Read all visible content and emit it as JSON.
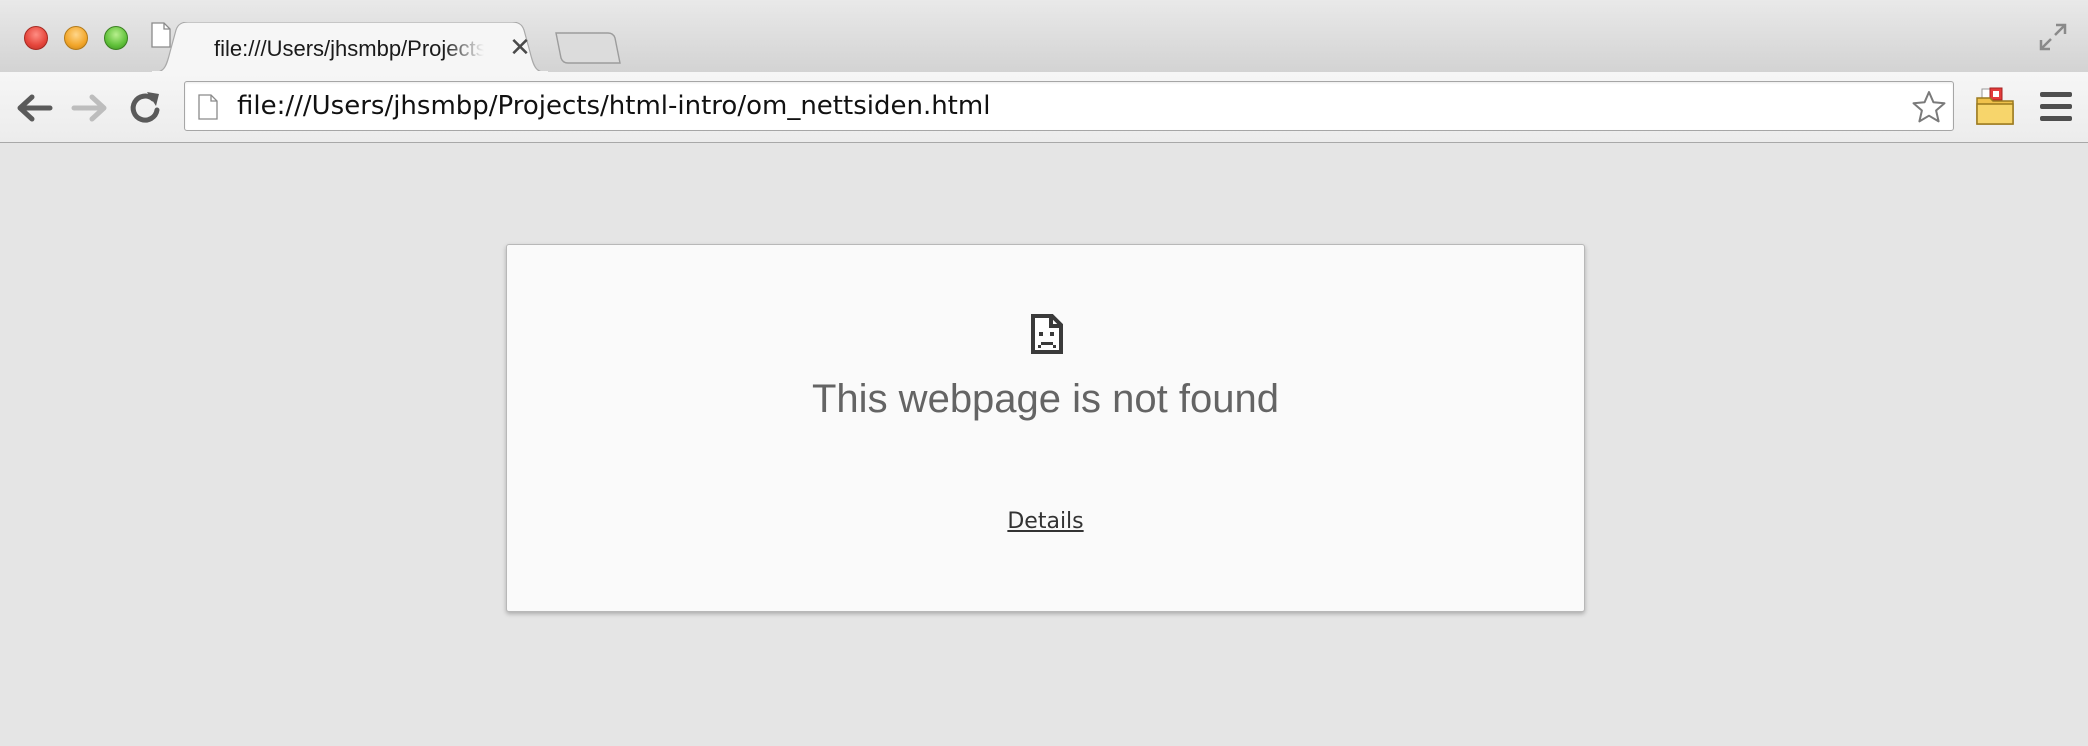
{
  "window": {
    "buttons": [
      "close",
      "minimize",
      "zoom"
    ]
  },
  "tabs": [
    {
      "title": "file:///Users/jhsmbp/Projects/html-intro/om_nettsiden.html",
      "icon": "page-icon",
      "close_glyph": "✕",
      "active": true
    }
  ],
  "toolbar": {
    "back_icon": "arrow-left-icon",
    "forward_icon": "arrow-right-icon",
    "reload_icon": "reload-icon",
    "omnibox": {
      "value": "file:///Users/jhsmbp/Projects/html-intro/om_nettsiden.html",
      "icon": "page-icon",
      "bookmark_icon": "star-icon"
    },
    "extension_icon": "folder-extension-icon",
    "menu_icon": "hamburger-menu-icon"
  },
  "error_page": {
    "icon": "sad-page-icon",
    "title": "This webpage is not found",
    "details_link": "Details"
  },
  "colors": {
    "page_background": "#e5e5e5",
    "card_background": "#fafafa",
    "title_text": "#646464"
  }
}
